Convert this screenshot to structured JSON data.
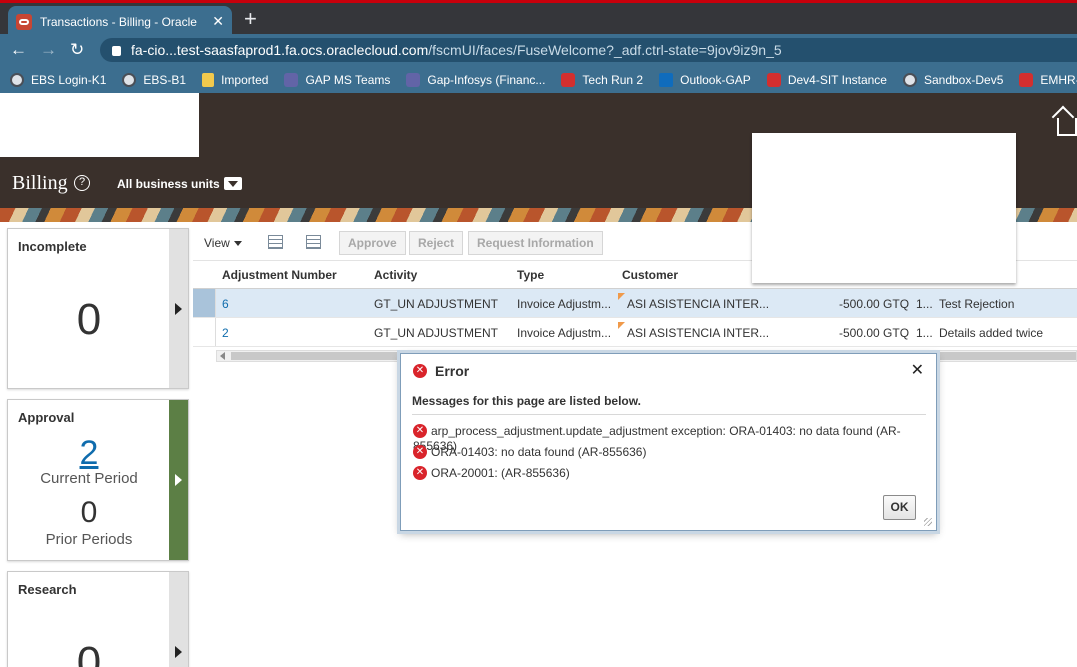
{
  "browser": {
    "tab_title": "Transactions - Billing - Oracle Fus",
    "tab_close": "✕",
    "new_tab": "+",
    "url_host": "fa-cio...test-saasfaprod1.fa.ocs.oraclecloud.com",
    "url_path": "/fscmUI/faces/FuseWelcome?_adf.ctrl-state=9jov9iz9n_5",
    "bookmarks": [
      {
        "label": "EBS Login-K1",
        "icon": "globe-icon"
      },
      {
        "label": "EBS-B1",
        "icon": "globe-icon"
      },
      {
        "label": "Imported",
        "icon": "folder-icon"
      },
      {
        "label": "GAP MS Teams",
        "icon": "teams-icon"
      },
      {
        "label": "Gap-Infosys (Financ...",
        "icon": "teams-icon"
      },
      {
        "label": "Tech Run 2",
        "icon": "oracle-icon"
      },
      {
        "label": "Outlook-GAP",
        "icon": "outlook-icon"
      },
      {
        "label": "Dev4-SIT Instance",
        "icon": "oracle-icon"
      },
      {
        "label": "Sandbox-Dev5",
        "icon": "globe-icon"
      },
      {
        "label": "EMHR-BUsiness",
        "icon": "oracle-icon"
      }
    ]
  },
  "header": {
    "title": "Billing",
    "help": "?",
    "business_units": "All business units"
  },
  "infolets": {
    "incomplete": {
      "title": "Incomplete",
      "count": "0"
    },
    "approval": {
      "title": "Approval",
      "current_count": "2",
      "current_label": "Current Period",
      "prior_count": "0",
      "prior_label": "Prior Periods"
    },
    "research": {
      "title": "Research",
      "count": "0"
    }
  },
  "toolbar": {
    "view": "View",
    "approve": "Approve",
    "reject": "Reject",
    "request_info": "Request Information"
  },
  "table": {
    "columns": [
      "Adjustment Number",
      "Activity",
      "Type",
      "Customer"
    ],
    "rows": [
      {
        "number": "6",
        "activity": "GT_UN ADJUSTMENT",
        "type": "Invoice Adjustm...",
        "customer": "ASI ASISTENCIA INTER...",
        "amount": "-500.00 GTQ",
        "extra": "1...",
        "reason": "Test Rejection"
      },
      {
        "number": "2",
        "activity": "GT_UN ADJUSTMENT",
        "type": "Invoice Adjustm...",
        "customer": "ASI ASISTENCIA INTER...",
        "amount": "-500.00 GTQ",
        "extra": "1...",
        "reason": "Details added twice"
      }
    ]
  },
  "dialog": {
    "title": "Error",
    "close": "✕",
    "subtitle": "Messages for this page are listed below.",
    "messages": [
      "arp_process_adjustment.update_adjustment exception: ORA-01403: no data found (AR-855636)",
      "ORA-01403: no data found (AR-855636)",
      "ORA-20001: (AR-855636)"
    ],
    "ok": "OK"
  },
  "colors": {
    "chrome_accent": "#3c6e8f",
    "oracle_header": "#3a302b",
    "link": "#0f6cad",
    "error_red": "#d9242b",
    "approval_green": "#5c7f45"
  }
}
